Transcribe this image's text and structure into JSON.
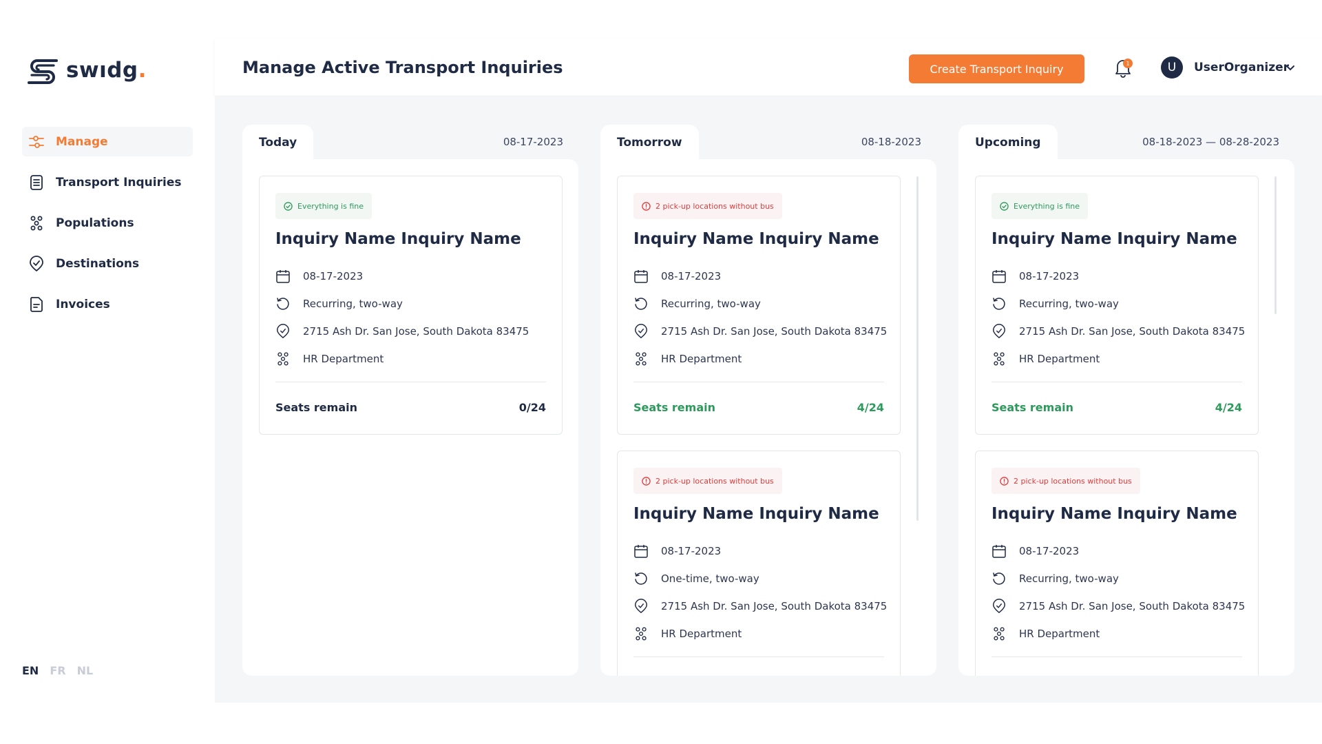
{
  "brand": {
    "name_prefix": "swıdg",
    "name_suffix": "."
  },
  "nav": [
    {
      "label": "Manage",
      "icon": "sliders-icon",
      "active": true
    },
    {
      "label": "Transport Inquiries",
      "icon": "document-list-icon",
      "active": false
    },
    {
      "label": "Populations",
      "icon": "group-icon",
      "active": false
    },
    {
      "label": "Destinations",
      "icon": "location-check-icon",
      "active": false
    },
    {
      "label": "Invoices",
      "icon": "invoice-icon",
      "active": false
    }
  ],
  "languages": {
    "en": "EN",
    "fr": "FR",
    "nl": "NL"
  },
  "header": {
    "title": "Manage Active Transport Inquiries",
    "create_label": "Create Transport Inquiry",
    "notification_count": "1",
    "avatar_initial": "U",
    "username": "UserOrganizer"
  },
  "colors": {
    "accent": "#f47b34",
    "navy": "#1f2a44",
    "success": "#2c9a5a",
    "danger": "#e23b3b",
    "background": "#f5f6f8"
  },
  "columns": [
    {
      "tab": "Today",
      "date": "08-17-2023",
      "cards": [
        {
          "status": "Everything is fine",
          "status_type": "ok",
          "title": "Inquiry Name Inquiry Name",
          "date": "08-17-2023",
          "recurrence": "Recurring, two-way",
          "address": "2715 Ash Dr. San Jose, South Dakota 83475",
          "population": "HR Department",
          "seats_label": "Seats remain",
          "seats_value": "0/24",
          "seats_ok": false
        }
      ]
    },
    {
      "tab": "Tomorrow",
      "date": "08-18-2023",
      "cards": [
        {
          "status": "2 pick-up locations without bus",
          "status_type": "warn",
          "title": "Inquiry Name Inquiry Name",
          "date": "08-17-2023",
          "recurrence": "Recurring, two-way",
          "address": "2715 Ash Dr. San Jose, South Dakota 83475",
          "population": "HR Department",
          "seats_label": "Seats remain",
          "seats_value": "4/24",
          "seats_ok": true
        },
        {
          "status": "2 pick-up locations without bus",
          "status_type": "warn",
          "title": "Inquiry Name Inquiry Name",
          "date": "08-17-2023",
          "recurrence": "One-time, two-way",
          "address": "2715 Ash Dr. San Jose, South Dakota 83475",
          "population": "HR Department"
        }
      ]
    },
    {
      "tab": "Upcoming",
      "date": "08-18-2023 — 08-28-2023",
      "cards": [
        {
          "status": "Everything is fine",
          "status_type": "ok",
          "title": "Inquiry Name Inquiry Name",
          "date": "08-17-2023",
          "recurrence": "Recurring, two-way",
          "address": "2715 Ash Dr. San Jose, South Dakota 83475",
          "population": "HR Department",
          "seats_label": "Seats remain",
          "seats_value": "4/24",
          "seats_ok": true
        },
        {
          "status": "2 pick-up locations without bus",
          "status_type": "warn",
          "title": "Inquiry Name Inquiry Name",
          "date": "08-17-2023",
          "recurrence": "Recurring, two-way",
          "address": "2715 Ash Dr. San Jose, South Dakota 83475",
          "population": "HR Department"
        }
      ]
    }
  ]
}
